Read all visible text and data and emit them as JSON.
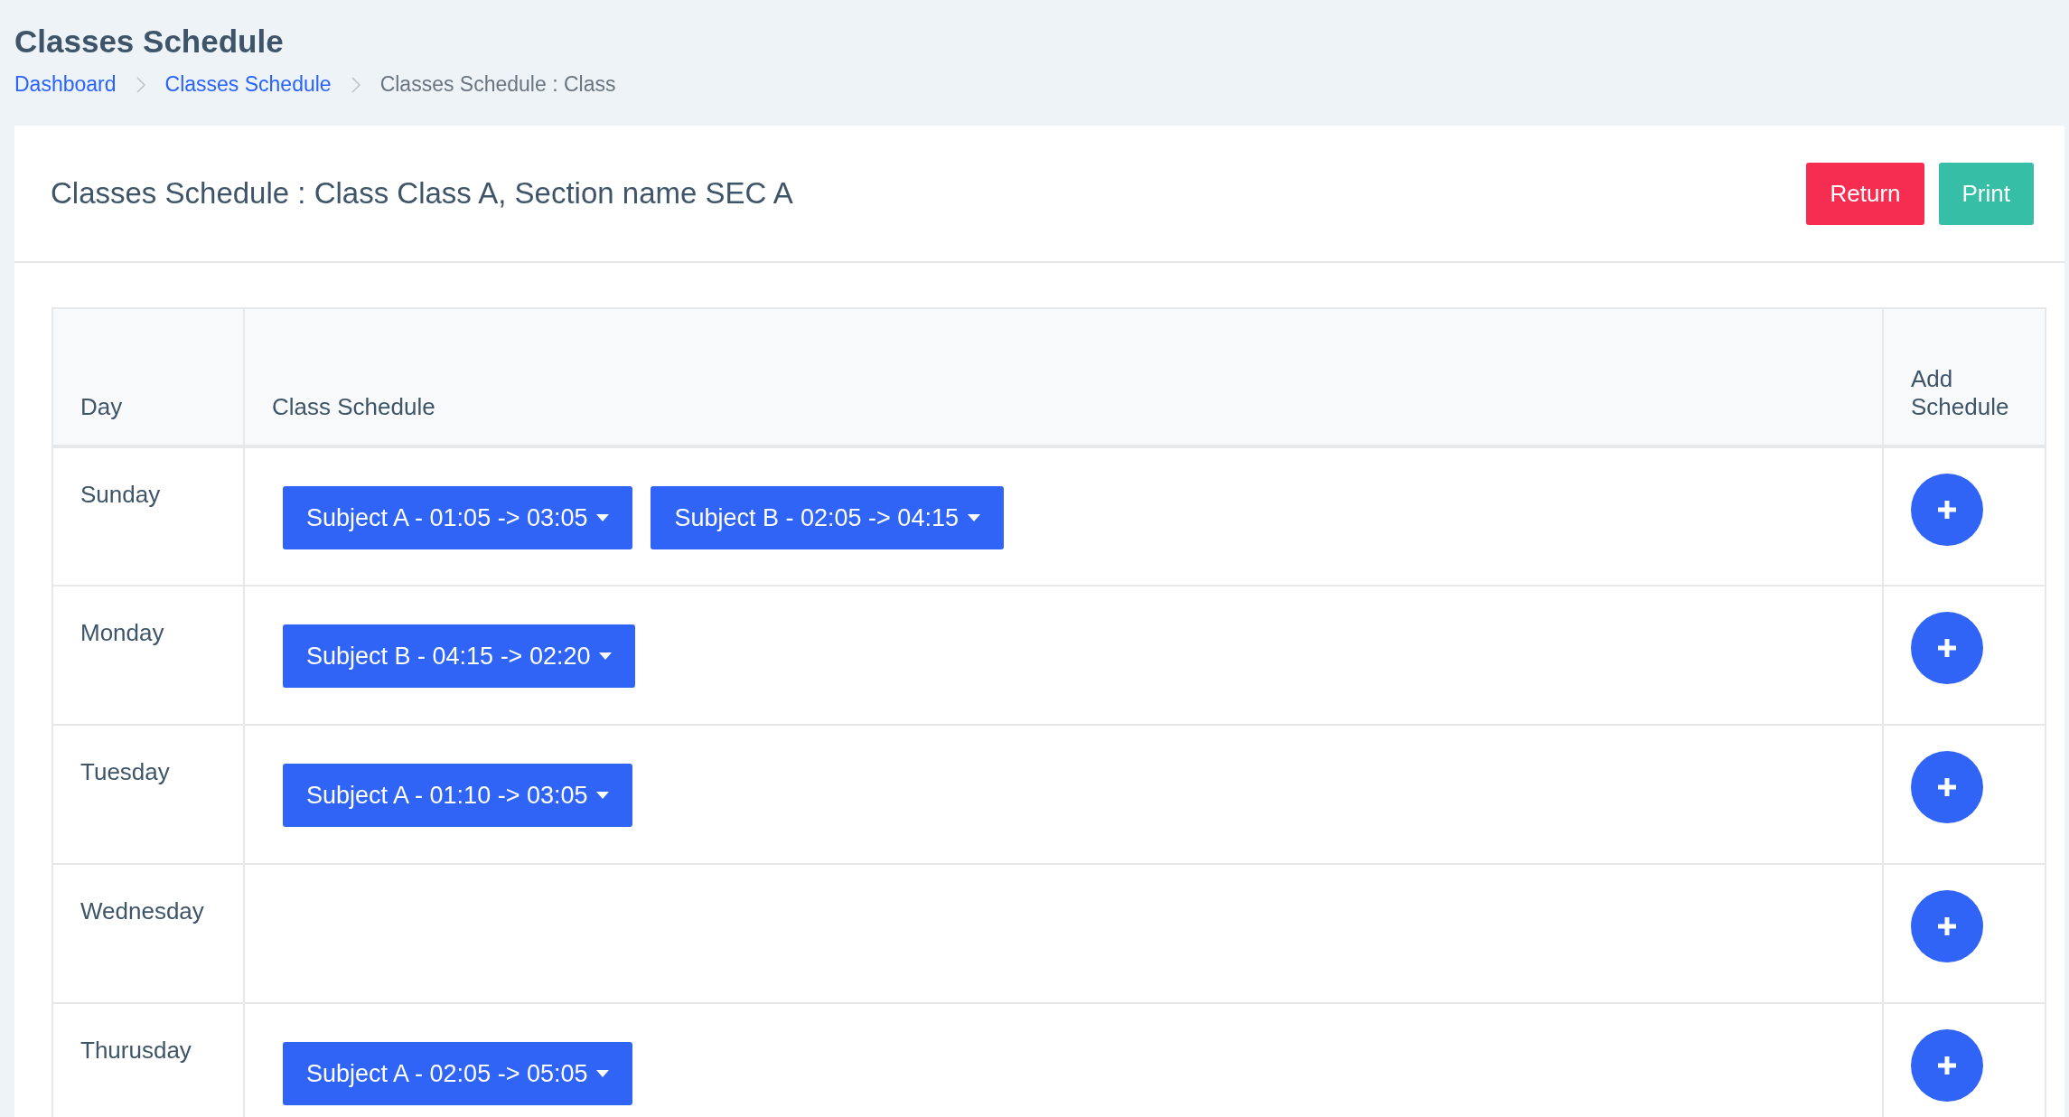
{
  "page_title": "Classes Schedule",
  "breadcrumb": [
    {
      "label": "Dashboard",
      "kind": "link"
    },
    {
      "label": "Classes Schedule",
      "kind": "link"
    },
    {
      "label": "Classes Schedule : Class",
      "kind": "current"
    }
  ],
  "card": {
    "title": "Classes Schedule : Class Class A, Section name SEC A",
    "buttons": [
      {
        "label": "Return",
        "kind": "danger"
      },
      {
        "label": "Print",
        "kind": "success"
      }
    ]
  },
  "table": {
    "columns": [
      "Day",
      "Class Schedule",
      "Add Schedule"
    ],
    "rows": [
      {
        "day": "Sunday",
        "schedules": [
          "Subject A - 01:05 -> 03:05",
          "Subject B - 02:05 -> 04:15"
        ]
      },
      {
        "day": "Monday",
        "schedules": [
          "Subject B - 04:15 -> 02:20"
        ]
      },
      {
        "day": "Tuesday",
        "schedules": [
          "Subject A - 01:10 -> 03:05"
        ]
      },
      {
        "day": "Wednesday",
        "schedules": []
      },
      {
        "day": "Thurusday",
        "schedules": [
          "Subject A - 02:05 -> 05:05"
        ]
      }
    ]
  }
}
